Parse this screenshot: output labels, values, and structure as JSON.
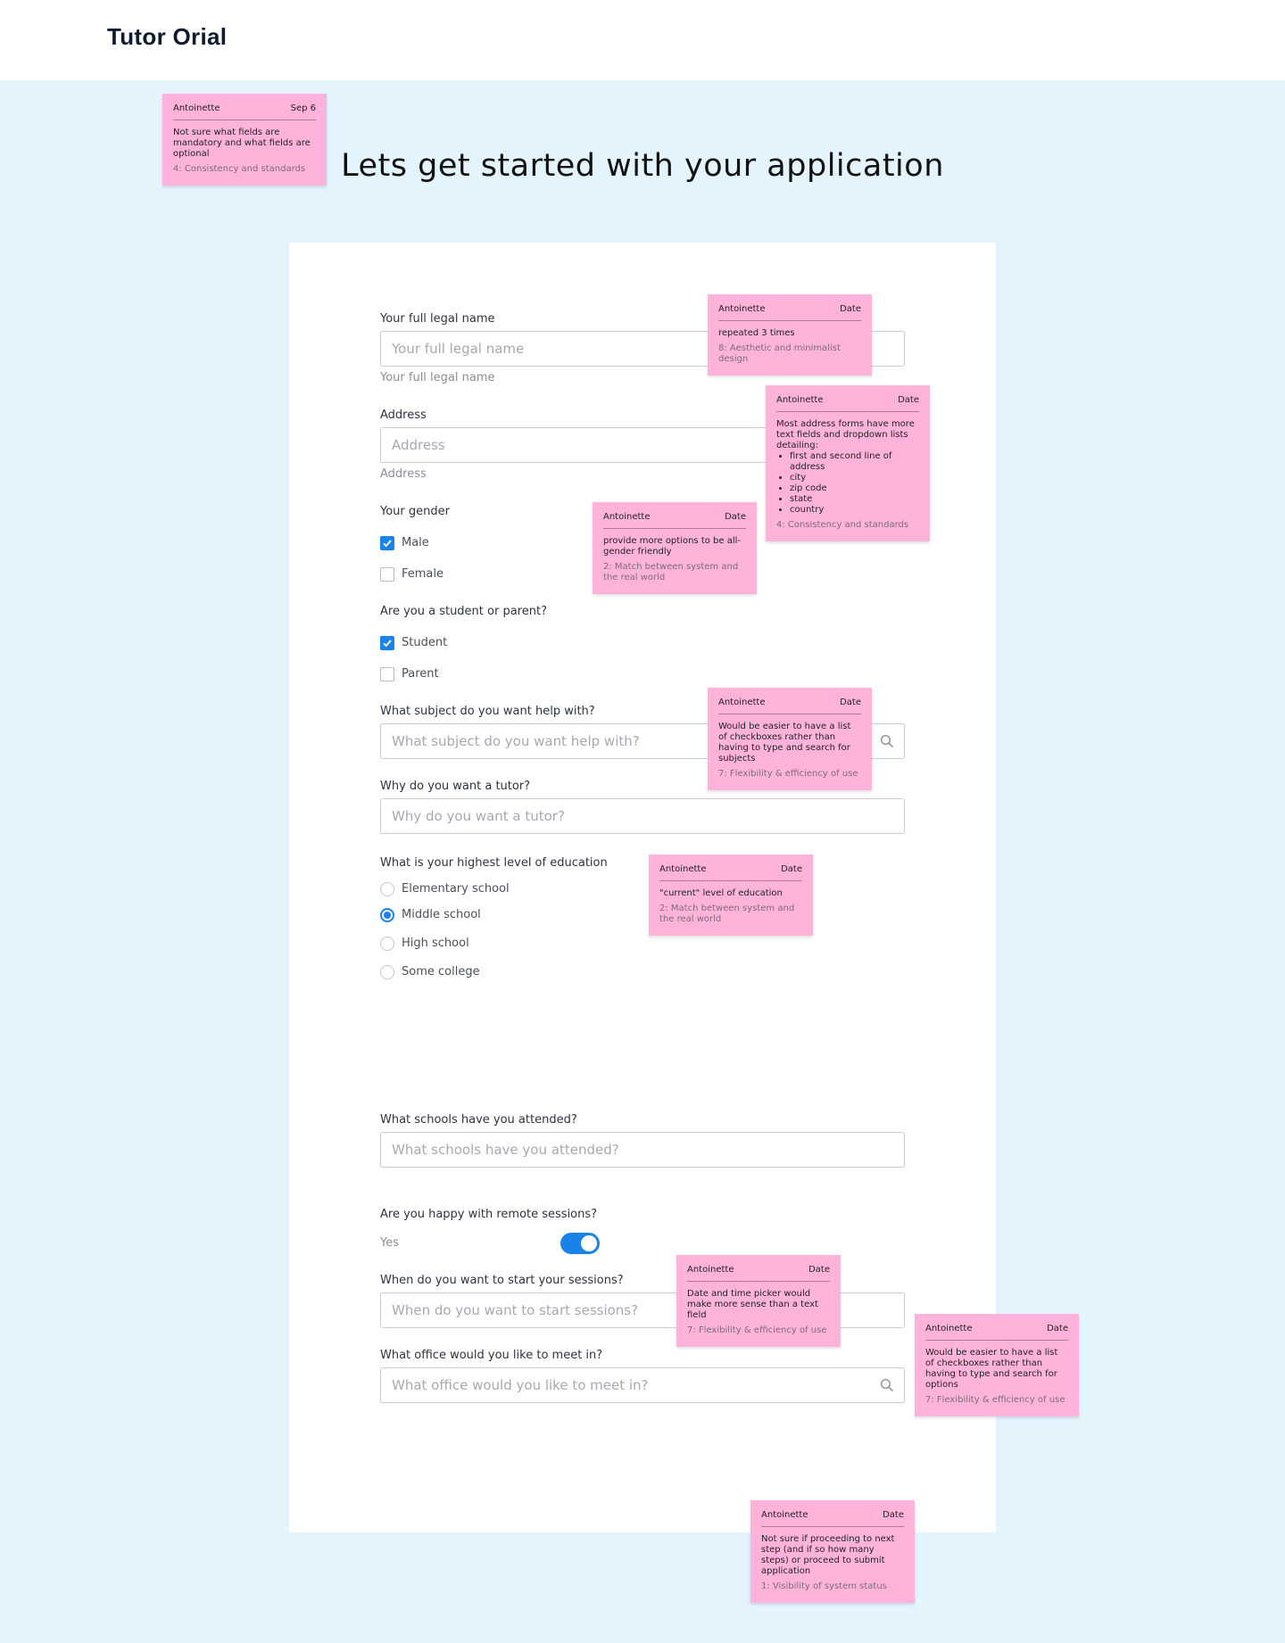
{
  "header": {
    "brand": "Tutor Orial"
  },
  "page": {
    "title": "Lets get started with your application"
  },
  "form": {
    "name": {
      "label": "Your full legal name",
      "placeholder": "Your full legal name",
      "helper": "Your full legal name"
    },
    "address": {
      "label": "Address",
      "placeholder": "Address",
      "helper": "Address"
    },
    "gender": {
      "label": "Your gender",
      "options": [
        {
          "label": "Male",
          "checked": true
        },
        {
          "label": "Female",
          "checked": false
        }
      ]
    },
    "role": {
      "label": "Are you a student or parent?",
      "options": [
        {
          "label": "Student",
          "checked": true
        },
        {
          "label": "Parent",
          "checked": false
        }
      ]
    },
    "subject": {
      "label": "What subject do you want help with?",
      "placeholder": "What subject do you want help with?"
    },
    "reason": {
      "label": "Why do you want a tutor?",
      "placeholder": "Why do you want a tutor?"
    },
    "education": {
      "label": "What is your highest level of education",
      "options": [
        "Elementary school",
        "Middle school",
        "High school",
        "Some college"
      ],
      "selected": "Middle school"
    },
    "schools": {
      "label": "What schools have you attended?",
      "placeholder": "What schools have you attended?"
    },
    "remote": {
      "label": "Are you happy with remote sessions?",
      "value_label": "Yes",
      "enabled": true
    },
    "start": {
      "label": "When do you want to start your sessions?",
      "placeholder": "When do you want to start sessions?"
    },
    "office": {
      "label": "What office would you like to meet in?",
      "placeholder": "What office would you like to meet in?"
    }
  },
  "notes": [
    {
      "author": "Antoinette",
      "date": "Sep 6",
      "text": "Not sure what fields are mandatory and what fields are optional",
      "tag": "4: Consistency and standards"
    },
    {
      "author": "Antoinette",
      "date": "Date",
      "text": "repeated 3 times",
      "tag": "8: Aesthetic and minimalist design"
    },
    {
      "author": "Antoinette",
      "date": "Date",
      "text": "Most address forms have more text fields and dropdown lists detailing:",
      "items": [
        "first and second line of address",
        "city",
        "zip code",
        "state",
        "country"
      ],
      "tag": "4: Consistency and standards"
    },
    {
      "author": "Antoinette",
      "date": "Date",
      "text": "provide more options to be all-gender friendly",
      "tag": "2: Match between system and the real world"
    },
    {
      "author": "Antoinette",
      "date": "Date",
      "text": "Would be easier to have a list of checkboxes rather than having to type and search for subjects",
      "tag": "7: Flexibility & efficiency of use"
    },
    {
      "author": "Antoinette",
      "date": "Date",
      "text": "\"current\" level of education",
      "tag": "2: Match between system and the real world"
    },
    {
      "author": "Antoinette",
      "date": "Date",
      "text": "Date and time picker would make more sense than a text field",
      "tag": "7: Flexibility & efficiency of use"
    },
    {
      "author": "Antoinette",
      "date": "Date",
      "text": "Would be easier to have a list of checkboxes rather than having to type and search for options",
      "tag": "7: Flexibility & efficiency of use"
    },
    {
      "author": "Antoinette",
      "date": "Date",
      "text": "Not sure if proceeding to next step (and if so how many steps) or proceed to submit application",
      "tag": "1: Visibility of system status"
    }
  ],
  "colors": {
    "background": "#e3f4fd",
    "accent": "#1a83e8",
    "sticky_note": "#ffb3db"
  }
}
